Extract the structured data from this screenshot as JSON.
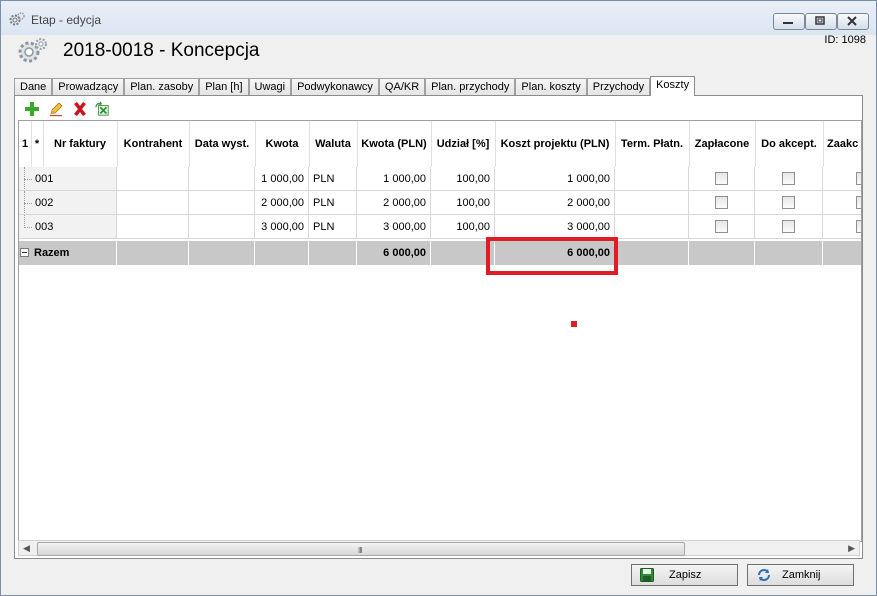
{
  "window": {
    "title": "Etap - edycja",
    "phase_title": "2018-0018 - Koncepcja",
    "id_label": "ID: 1098"
  },
  "tabs": [
    {
      "label": "Dane",
      "active": false
    },
    {
      "label": "Prowadzący",
      "active": false
    },
    {
      "label": "Plan. zasoby",
      "active": false
    },
    {
      "label": "Plan [h]",
      "active": false
    },
    {
      "label": "Uwagi",
      "active": false
    },
    {
      "label": "Podwykonawcy",
      "active": false
    },
    {
      "label": "QA/KR",
      "active": false
    },
    {
      "label": "Plan. przychody",
      "active": false
    },
    {
      "label": "Plan. koszty",
      "active": false
    },
    {
      "label": "Przychody",
      "active": false
    },
    {
      "label": "Koszty",
      "active": true
    }
  ],
  "toolbar": {
    "icons": [
      "add-icon",
      "edit-icon",
      "delete-icon",
      "excel-export-icon"
    ]
  },
  "grid": {
    "columns": [
      "1",
      "*",
      "Nr faktury",
      "Kontrahent",
      "Data wyst.",
      "Kwota",
      "Waluta",
      "Kwota (PLN)",
      "Udział [%]",
      "Koszt projektu (PLN)",
      "Term. Płatn.",
      "Zapłacone",
      "Do akcept.",
      "Zaakc"
    ],
    "rows": [
      {
        "nr": "001",
        "kontrahent": "",
        "data": "",
        "kwota": "1 000,00",
        "waluta": "PLN",
        "kwota_pln": "1 000,00",
        "udzial": "100,00",
        "koszt": "1 000,00",
        "term": ""
      },
      {
        "nr": "002",
        "kontrahent": "",
        "data": "",
        "kwota": "2 000,00",
        "waluta": "PLN",
        "kwota_pln": "2 000,00",
        "udzial": "100,00",
        "koszt": "2 000,00",
        "term": ""
      },
      {
        "nr": "003",
        "kontrahent": "",
        "data": "",
        "kwota": "3 000,00",
        "waluta": "PLN",
        "kwota_pln": "3 000,00",
        "udzial": "100,00",
        "koszt": "3 000,00",
        "term": ""
      }
    ],
    "summary": {
      "label": "Razem",
      "kwota_pln": "6 000,00",
      "koszt": "6 000,00"
    },
    "scroll_grip": "III"
  },
  "buttons": {
    "save": "Zapisz",
    "close": "Zamknij"
  },
  "colors": {
    "highlight": "#e21b24",
    "summary_row": "#c8c8c8"
  }
}
